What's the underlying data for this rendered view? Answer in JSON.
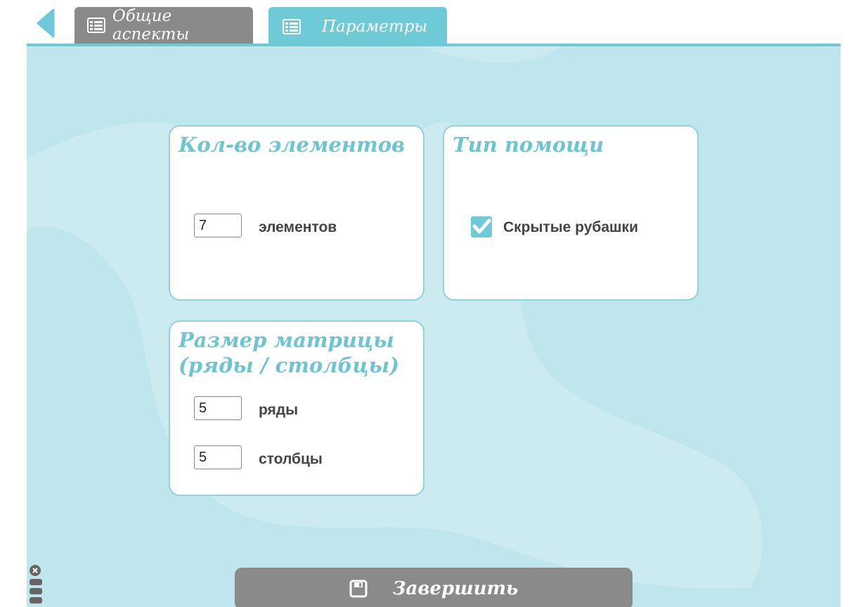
{
  "tabs": {
    "general_label": "Общие аспекты",
    "params_label": "Параметры"
  },
  "cards": {
    "elements": {
      "title": "Кол-во элементов",
      "value": "7",
      "label": "элементов"
    },
    "help": {
      "title": "Тип помощи",
      "checkbox_label": "Скрытые рубашки",
      "checked": true
    },
    "matrix": {
      "title_line1": "Размер матрицы",
      "title_line2": "(ряды / столбцы)",
      "rows_value": "5",
      "rows_label": "ряды",
      "cols_value": "5",
      "cols_label": "столбцы"
    }
  },
  "footer": {
    "finish_label": "Завершить"
  },
  "colors": {
    "accent": "#6fcad8",
    "background": "#bfe6ec",
    "inactive": "#8a8a8a"
  }
}
